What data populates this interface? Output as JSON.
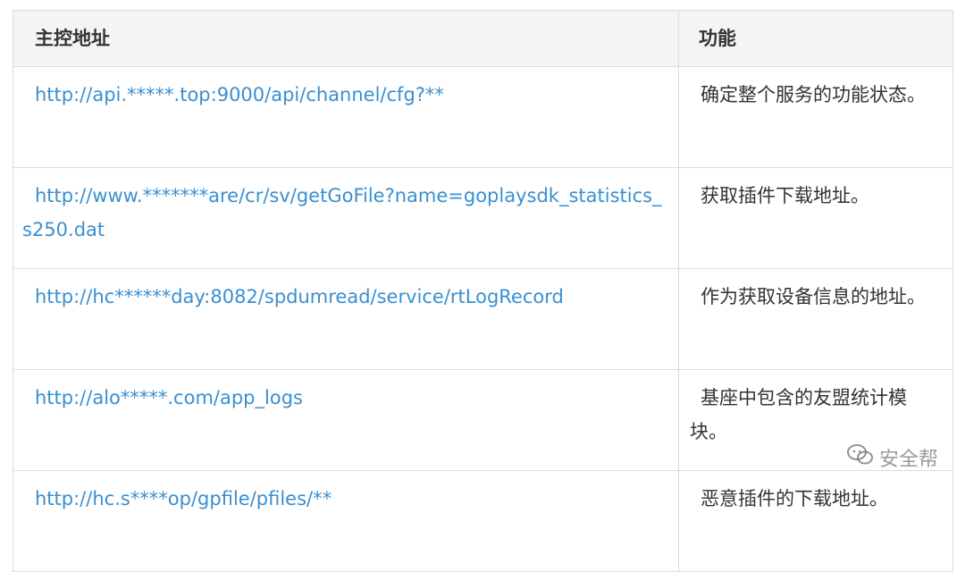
{
  "table": {
    "headers": {
      "address": "主控地址",
      "function": "功能"
    },
    "rows": [
      {
        "url": "http://api.*****.top:9000/api/channel/cfg?**",
        "function": "确定整个服务的功能状态。"
      },
      {
        "url": "http://www.*******are/cr/sv/getGoFile?name=goplaysdk_statistics_s250.dat",
        "function": "获取插件下载地址。"
      },
      {
        "url": "http://hc******day:8082/spdumread/service/rtLogRecord",
        "function": "作为获取设备信息的地址。"
      },
      {
        "url": "http://alo*****.com/app_logs",
        "function": "基座中包含的友盟统计模块。"
      },
      {
        "url": "http://hc.s****op/gpfile/pfiles/**",
        "function": "恶意插件的下载地址。"
      }
    ]
  },
  "watermark": {
    "icon": "wechat-icon",
    "text": "安全帮"
  }
}
